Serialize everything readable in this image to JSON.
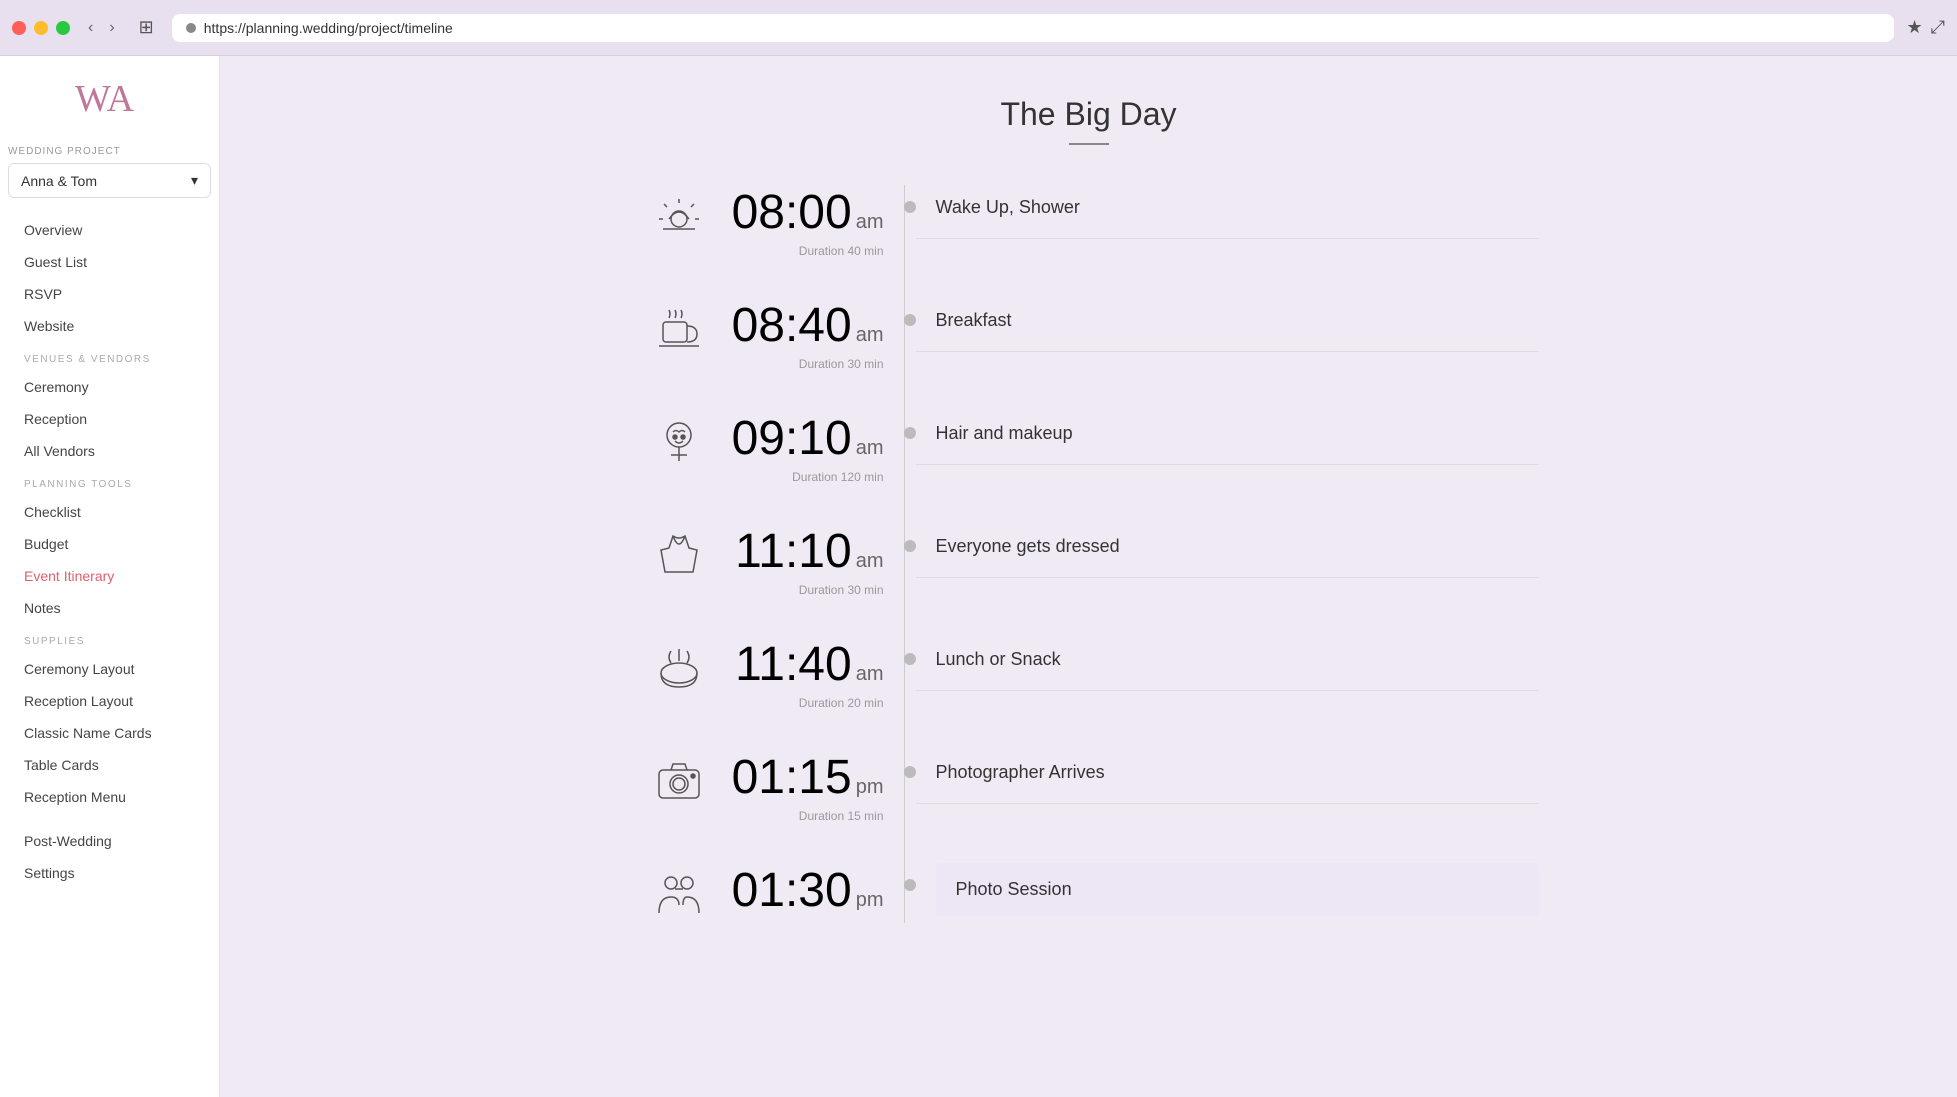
{
  "browser": {
    "url": "https://planning.wedding/project/timeline",
    "back_label": "‹",
    "forward_label": "›",
    "sidebar_icon": "⊞",
    "bookmark_icon": "★",
    "expand_icon": "⤢"
  },
  "sidebar": {
    "logo_text": "WA",
    "project_section_label": "WEDDING PROJECT",
    "project_name": "Anna & Tom",
    "nav_sections": [
      {
        "items": [
          {
            "label": "Overview",
            "active": false
          },
          {
            "label": "Guest List",
            "active": false
          },
          {
            "label": "RSVP",
            "active": false
          },
          {
            "label": "Website",
            "active": false
          }
        ]
      },
      {
        "section_label": "VENUES & VENDORS",
        "items": [
          {
            "label": "Ceremony",
            "active": false
          },
          {
            "label": "Reception",
            "active": false
          },
          {
            "label": "All Vendors",
            "active": false
          }
        ]
      },
      {
        "section_label": "PLANNING TOOLS",
        "items": [
          {
            "label": "Checklist",
            "active": false
          },
          {
            "label": "Budget",
            "active": false
          },
          {
            "label": "Event Itinerary",
            "active": true
          },
          {
            "label": "Notes",
            "active": false
          }
        ]
      },
      {
        "section_label": "SUPPLIES",
        "items": [
          {
            "label": "Ceremony Layout",
            "active": false
          },
          {
            "label": "Reception Layout",
            "active": false
          },
          {
            "label": "Classic Name Cards",
            "active": false
          },
          {
            "label": "Table Cards",
            "active": false
          },
          {
            "label": "Reception Menu",
            "active": false
          }
        ]
      },
      {
        "items": [
          {
            "label": "Post-Wedding",
            "active": false
          },
          {
            "label": "Settings",
            "active": false
          }
        ]
      }
    ]
  },
  "main": {
    "title": "The Big Day",
    "timeline_events": [
      {
        "time": "08:00",
        "ampm": "am",
        "duration": "Duration 40 min",
        "event": "Wake Up, Shower",
        "icon_type": "sunrise"
      },
      {
        "time": "08:40",
        "ampm": "am",
        "duration": "Duration 30 min",
        "event": "Breakfast",
        "icon_type": "coffee"
      },
      {
        "time": "09:10",
        "ampm": "am",
        "duration": "Duration 120 min",
        "event": "Hair and makeup",
        "icon_type": "makeup"
      },
      {
        "time": "11:10",
        "ampm": "am",
        "duration": "Duration 30 min",
        "event": "Everyone gets dressed",
        "icon_type": "dress"
      },
      {
        "time": "11:40",
        "ampm": "am",
        "duration": "Duration 20 min",
        "event": "Lunch or Snack",
        "icon_type": "food"
      },
      {
        "time": "01:15",
        "ampm": "pm",
        "duration": "Duration 15 min",
        "event": "Photographer Arrives",
        "icon_type": "camera"
      },
      {
        "time": "01:30",
        "ampm": "pm",
        "duration": "",
        "event": "Photo Session",
        "icon_type": "people"
      }
    ]
  }
}
